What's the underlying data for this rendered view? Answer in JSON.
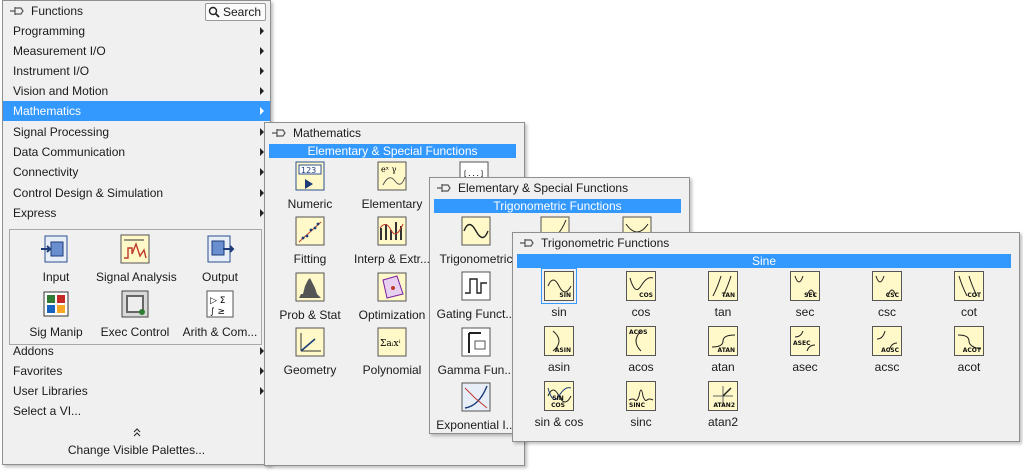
{
  "functions": {
    "title": "Functions",
    "search_label": "Search",
    "menu": [
      {
        "label": "Programming",
        "arrow": true
      },
      {
        "label": "Measurement I/O",
        "arrow": true
      },
      {
        "label": "Instrument I/O",
        "arrow": true
      },
      {
        "label": "Vision and Motion",
        "arrow": true
      },
      {
        "label": "Mathematics",
        "arrow": true,
        "selected": true
      },
      {
        "label": "Signal Processing",
        "arrow": true
      },
      {
        "label": "Data Communication",
        "arrow": true
      },
      {
        "label": "Connectivity",
        "arrow": true
      },
      {
        "label": "Control Design & Simulation",
        "arrow": true
      },
      {
        "label": "Express",
        "arrow": true
      }
    ],
    "express_items": [
      {
        "label": "Input",
        "icon": "input-icon"
      },
      {
        "label": "Signal Analysis",
        "icon": "signal-analysis-icon"
      },
      {
        "label": "Output",
        "icon": "output-icon"
      },
      {
        "label": "Sig Manip",
        "icon": "sig-manip-icon"
      },
      {
        "label": "Exec Control",
        "icon": "exec-control-icon"
      },
      {
        "label": "Arith & Com...",
        "icon": "arith-comparison-icon"
      }
    ],
    "menu_lower": [
      {
        "label": "Addons",
        "arrow": true
      },
      {
        "label": "Favorites",
        "arrow": true
      },
      {
        "label": "User Libraries",
        "arrow": true
      },
      {
        "label": "Select a VI...",
        "arrow": false
      }
    ],
    "change_palettes": "Change Visible Palettes..."
  },
  "mathematics": {
    "title": "Mathematics",
    "highlight": "Elementary & Special Functions",
    "items": [
      {
        "label": "Numeric",
        "icon": "numeric-icon"
      },
      {
        "label": "Elementary",
        "icon": "elementary-icon"
      },
      {
        "label": "Fitting",
        "icon": "fitting-icon"
      },
      {
        "label": "Interp & Extr...",
        "icon": "interp-extrap-icon"
      },
      {
        "label": "Prob & Stat",
        "icon": "prob-stat-icon"
      },
      {
        "label": "Optimization",
        "icon": "optimization-icon"
      },
      {
        "label": "Geometry",
        "icon": "geometry-icon"
      },
      {
        "label": "Polynomial",
        "icon": "polynomial-icon"
      }
    ]
  },
  "elementary": {
    "title": "Elementary & Special Functions",
    "highlight": "Trigonometric Functions",
    "items": [
      {
        "label": "Trigonometric",
        "icon": "trigonometric-icon"
      },
      {
        "label": "Gating Funct...",
        "icon": "gating-functions-icon"
      },
      {
        "label": "Gamma Fun...",
        "icon": "gamma-functions-icon"
      },
      {
        "label": "Exponential I...",
        "icon": "exponential-icon"
      }
    ]
  },
  "trig": {
    "title": "Trigonometric Functions",
    "highlight": "Sine",
    "items": [
      {
        "label": "sin",
        "tag": "SIN",
        "icon": "sin-icon"
      },
      {
        "label": "cos",
        "tag": "COS",
        "icon": "cos-icon"
      },
      {
        "label": "tan",
        "tag": "TAN",
        "icon": "tan-icon"
      },
      {
        "label": "sec",
        "tag": "SEC",
        "icon": "sec-icon"
      },
      {
        "label": "csc",
        "tag": "CSC",
        "icon": "csc-icon"
      },
      {
        "label": "cot",
        "tag": "COT",
        "icon": "cot-icon"
      },
      {
        "label": "asin",
        "tag": "ASIN",
        "icon": "asin-icon"
      },
      {
        "label": "acos",
        "tag": "ACOS",
        "icon": "acos-icon"
      },
      {
        "label": "atan",
        "tag": "ATAN",
        "icon": "atan-icon"
      },
      {
        "label": "asec",
        "tag": "ASEC",
        "icon": "asec-icon"
      },
      {
        "label": "acsc",
        "tag": "ACSC",
        "icon": "acsc-icon"
      },
      {
        "label": "acot",
        "tag": "ACOT",
        "icon": "acot-icon"
      },
      {
        "label": "sin & cos",
        "tag": "SIN COS",
        "icon": "sin-cos-icon"
      },
      {
        "label": "sinc",
        "tag": "SINC",
        "icon": "sinc-icon"
      },
      {
        "label": "atan2",
        "tag": "ATAN2",
        "icon": "atan2-icon"
      }
    ]
  },
  "colors": {
    "highlight": "#3399ff",
    "palette_bg": "#f0f0f0",
    "icon_bg": "#fff8c8"
  }
}
